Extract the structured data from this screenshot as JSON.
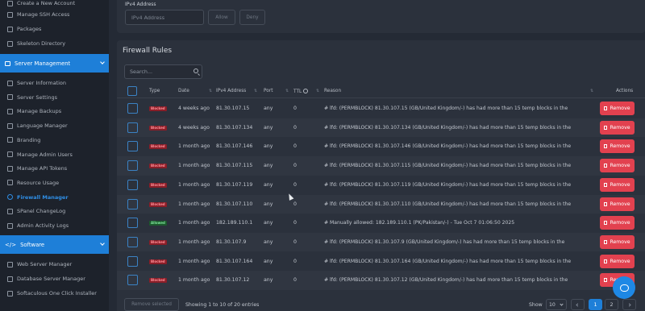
{
  "sidebar": {
    "items_top": [
      {
        "label": "Create a New Account",
        "icon": "user-plus-icon"
      },
      {
        "label": "Manage SSH Access",
        "icon": "terminal-icon"
      },
      {
        "label": "Packages",
        "icon": "package-icon"
      },
      {
        "label": "Skeleton Directory",
        "icon": "folder-icon"
      }
    ],
    "section_server": "Server Management",
    "items_server": [
      {
        "label": "Server Information",
        "icon": "info-icon"
      },
      {
        "label": "Server Settings",
        "icon": "settings-icon"
      },
      {
        "label": "Manage Backups",
        "icon": "history-icon"
      },
      {
        "label": "Language Manager",
        "icon": "language-icon"
      },
      {
        "label": "Branding",
        "icon": "brush-icon"
      },
      {
        "label": "Manage Admin Users",
        "icon": "users-icon"
      },
      {
        "label": "Manage API Tokens",
        "icon": "key-icon"
      },
      {
        "label": "Resource Usage",
        "icon": "gauge-icon"
      },
      {
        "label": "Firewall Manager",
        "icon": "shield-icon",
        "active": true
      },
      {
        "label": "SPanel ChangeLog",
        "icon": "document-icon"
      },
      {
        "label": "Admin Activity Logs",
        "icon": "list-icon"
      }
    ],
    "section_software": "Software",
    "items_software": [
      {
        "label": "Web Server Manager",
        "icon": "globe-icon"
      },
      {
        "label": "Database Server Manager",
        "icon": "database-icon"
      },
      {
        "label": "Softaculous One Click Installer",
        "icon": "app-icon"
      }
    ]
  },
  "ip_form": {
    "label": "IPv4 Address",
    "placeholder": "IPv4 Address",
    "allow_label": "Allow",
    "deny_label": "Deny"
  },
  "firewall": {
    "title": "Firewall Rules",
    "search_placeholder": "Search...",
    "columns": [
      "Type",
      "Date",
      "IPv4 Address",
      "Port",
      "TTL",
      "Reason",
      "Actions"
    ],
    "remove_label": "Remove",
    "rows": [
      {
        "type": "Blocked",
        "date": "4 weeks ago",
        "ip": "81.30.107.15",
        "port": "any",
        "ttl": "0",
        "reason": "# lfd: (PERMBLOCK) 81.30.107.15 (GB/United Kingdom/-) has had more than 15 temp blocks in the"
      },
      {
        "type": "Blocked",
        "date": "4 weeks ago",
        "ip": "81.30.107.134",
        "port": "any",
        "ttl": "0",
        "reason": "# lfd: (PERMBLOCK) 81.30.107.134 (GB/United Kingdom/-) has had more than 15 temp blocks in the"
      },
      {
        "type": "Blocked",
        "date": "1 month ago",
        "ip": "81.30.107.146",
        "port": "any",
        "ttl": "0",
        "reason": "# lfd: (PERMBLOCK) 81.30.107.146 (GB/United Kingdom/-) has had more than 15 temp blocks in the"
      },
      {
        "type": "Blocked",
        "date": "1 month ago",
        "ip": "81.30.107.115",
        "port": "any",
        "ttl": "0",
        "reason": "# lfd: (PERMBLOCK) 81.30.107.115 (GB/United Kingdom/-) has had more than 15 temp blocks in the"
      },
      {
        "type": "Blocked",
        "date": "1 month ago",
        "ip": "81.30.107.119",
        "port": "any",
        "ttl": "0",
        "reason": "# lfd: (PERMBLOCK) 81.30.107.119 (GB/United Kingdom/-) has had more than 15 temp blocks in the"
      },
      {
        "type": "Blocked",
        "date": "1 month ago",
        "ip": "81.30.107.110",
        "port": "any",
        "ttl": "0",
        "reason": "# lfd: (PERMBLOCK) 81.30.107.110 (GB/United Kingdom/-) has had more than 15 temp blocks in the"
      },
      {
        "type": "Allowed",
        "date": "1 month ago",
        "ip": "182.189.110.1",
        "port": "any",
        "ttl": "0",
        "reason": "# Manually allowed: 182.189.110.1 (PK/Pakistan/-) - Tue Oct 7 01:06:50 2025"
      },
      {
        "type": "Blocked",
        "date": "1 month ago",
        "ip": "81.30.107.9",
        "port": "any",
        "ttl": "0",
        "reason": "# lfd: (PERMBLOCK) 81.30.107.9 (GB/United Kingdom/-) has had more than 15 temp blocks in the"
      },
      {
        "type": "Blocked",
        "date": "1 month ago",
        "ip": "81.30.107.164",
        "port": "any",
        "ttl": "0",
        "reason": "# lfd: (PERMBLOCK) 81.30.107.164 (GB/United Kingdom/-) has had more than 15 temp blocks in the"
      },
      {
        "type": "Blocked",
        "date": "1 month ago",
        "ip": "81.30.107.12",
        "port": "any",
        "ttl": "0",
        "reason": "# lfd: (PERMBLOCK) 81.30.107.12 (GB/United Kingdom/-) has had more than 15 temp blocks in the"
      }
    ]
  },
  "footer": {
    "remove_selected": "Remove selected",
    "showing": "Showing 1 to 10 of 20 entries",
    "show_label": "Show",
    "per_page": "10",
    "pages": [
      "1",
      "2"
    ],
    "current_page": "1"
  },
  "colors": {
    "accent": "#1e7fd8",
    "danger": "#e2414f",
    "blocked_badge": "#8a1e28",
    "allowed_badge": "#1c5a2d"
  }
}
